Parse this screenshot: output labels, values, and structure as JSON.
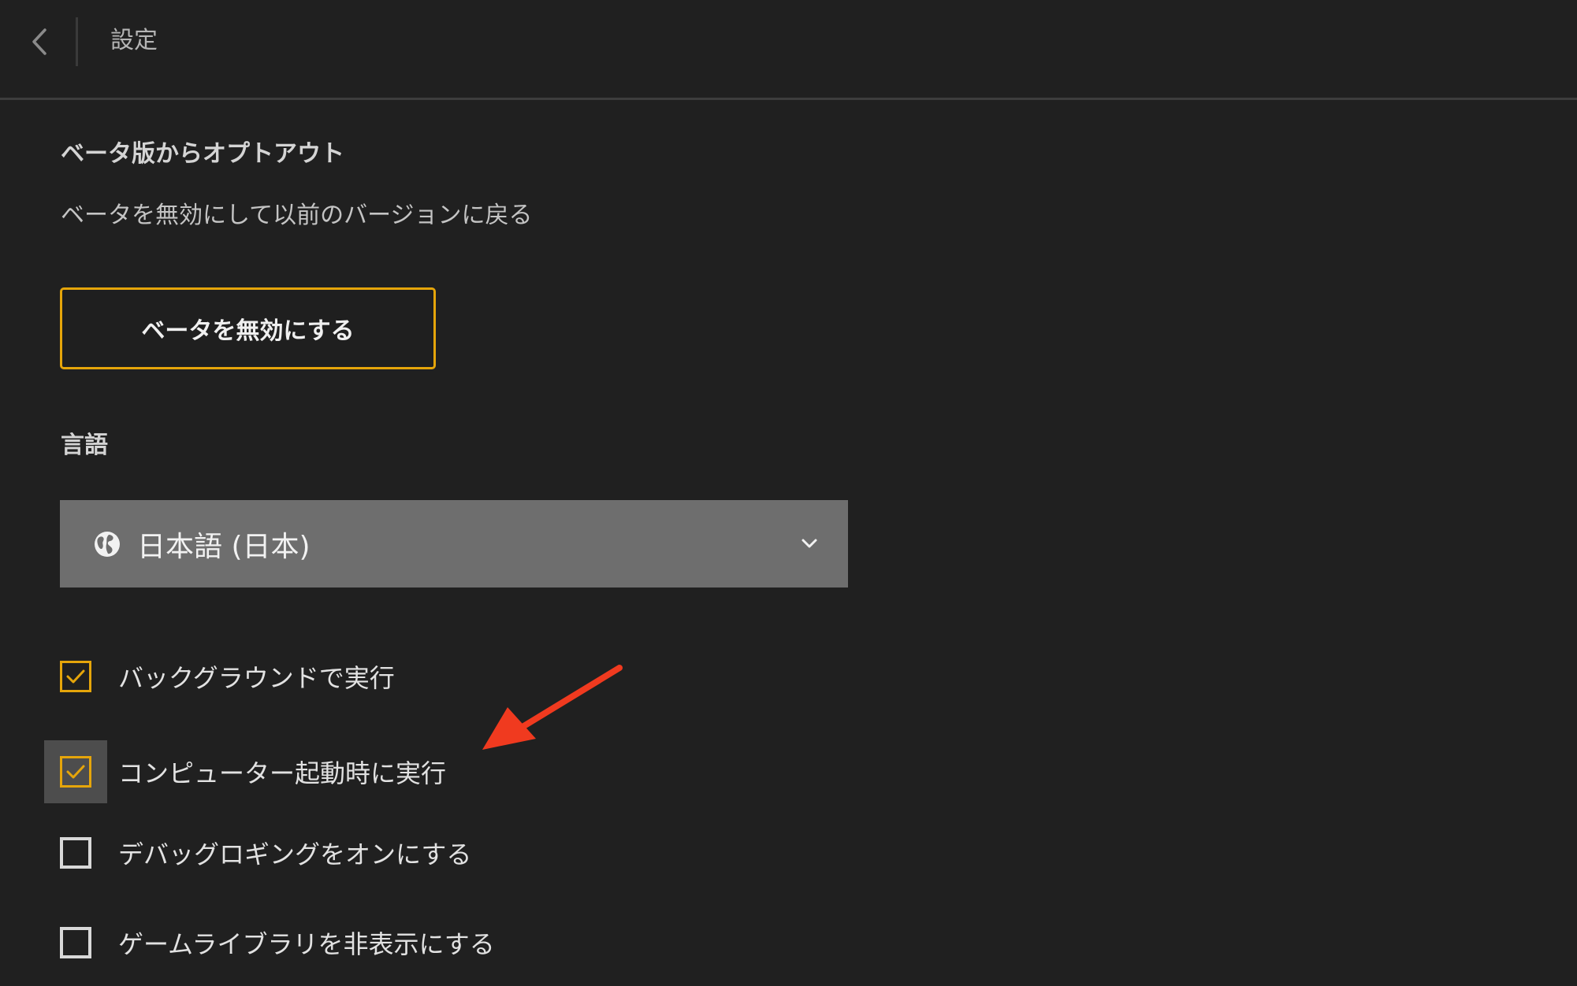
{
  "header": {
    "title": "設定",
    "back_icon": "chevron-left-icon"
  },
  "beta": {
    "title": "ベータ版からオプトアウト",
    "description": "ベータを無効にして以前のバージョンに戻る",
    "button_label": "ベータを無効にする"
  },
  "language": {
    "title": "言語",
    "selected": "日本語 (日本)",
    "icon": "globe-icon"
  },
  "options": [
    {
      "label": "バックグラウンドで実行",
      "checked": true
    },
    {
      "label": "コンピューター起動時に実行",
      "checked": true
    },
    {
      "label": "デバッグロギングをオンにする",
      "checked": false
    },
    {
      "label": "ゲームライブラリを非表示にする",
      "checked": false
    }
  ],
  "colors": {
    "background": "#202020",
    "accent": "#e5a50a",
    "select_bg": "#6e6e6e",
    "annotation": "#f03a1f"
  }
}
